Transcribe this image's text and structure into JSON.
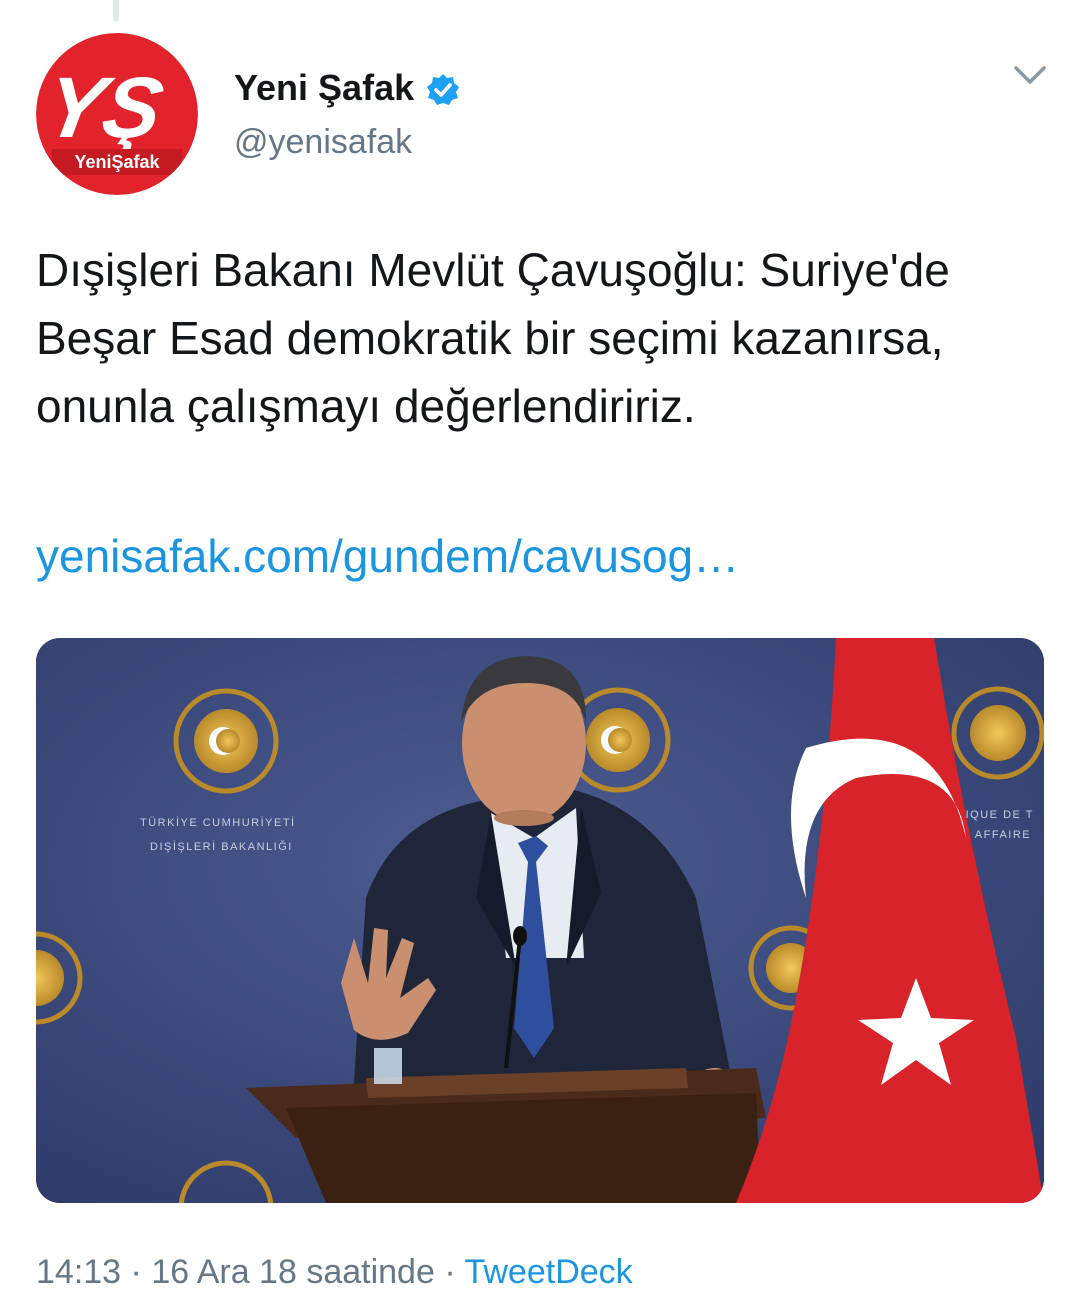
{
  "account": {
    "display_name": "Yeni Şafak",
    "handle": "@yenisafak",
    "verified": true,
    "avatar_logo_text": "YŞ",
    "avatar_brand_text": "YeniŞafak",
    "brand_color": "#e2232b"
  },
  "tweet": {
    "text": "Dışişleri Bakanı Mevlüt Çavuşoğlu: Suriye'de Beşar Esad demokratik bir seçimi kazanırsa, onunla çalışmayı değerlendiririz.",
    "link": "yenisafak.com/gundem/cavusog…",
    "link_color": "#1b95e0"
  },
  "media": {
    "backdrop_text_left": [
      "TÜRKİYE CUMHURİYETİ",
      "DIŞİŞLERİ BAKANLIĞI"
    ],
    "backdrop_text_right": [
      "LIQUE DE T",
      "S AFFAIRE"
    ],
    "backdrop_color": "#3a4a7c",
    "flag_color": "#d8232a"
  },
  "meta": {
    "time": "14:13",
    "separator": " · ",
    "date": "16 Ara 18 saatinde",
    "source": "TweetDeck"
  },
  "icons": {
    "verified": "verified-badge-icon",
    "menu": "chevron-down-icon"
  }
}
